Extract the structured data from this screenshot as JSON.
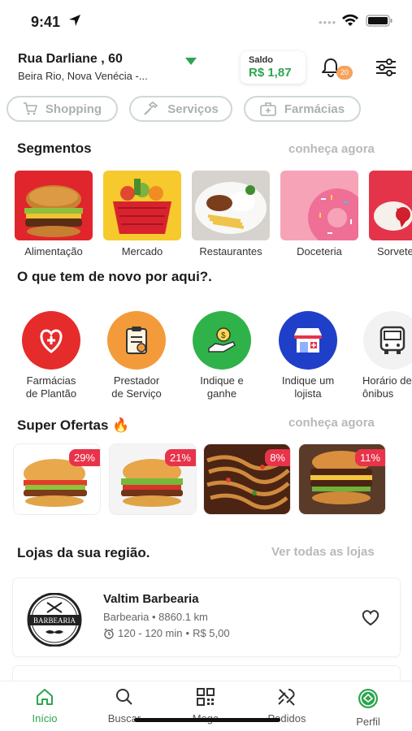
{
  "status": {
    "time": "9:41"
  },
  "header": {
    "street": "Rua Darliane , 60",
    "city": "Beira Rio, Nova Venécia -...",
    "saldo_label": "Saldo",
    "saldo_value": "R$ 1,87",
    "notifications": "20"
  },
  "chips": [
    {
      "label": "Shopping",
      "icon": "cart-icon"
    },
    {
      "label": "Serviços",
      "icon": "hammer-icon"
    },
    {
      "label": "Farmácias",
      "icon": "medkit-icon"
    }
  ],
  "segments": {
    "title": "Segmentos",
    "link": "conheça agora",
    "items": [
      {
        "label": "Alimentação"
      },
      {
        "label": "Mercado"
      },
      {
        "label": "Restaurantes"
      },
      {
        "label": "Doceteria"
      },
      {
        "label": "Sorvete"
      }
    ]
  },
  "news": {
    "title": "O que tem de novo por aqui?.",
    "items": [
      {
        "line1": "Farmácias",
        "line2": "de Plantão"
      },
      {
        "line1": "Prestador",
        "line2": "de Serviço"
      },
      {
        "line1": "Indique e",
        "line2": "ganhe"
      },
      {
        "line1": "Indique um",
        "line2": "lojista"
      },
      {
        "line1": "Horário de",
        "line2": "ônibus"
      }
    ]
  },
  "offers": {
    "title": "Super Ofertas 🔥",
    "link": "conheça agora",
    "items": [
      {
        "discount": "29%"
      },
      {
        "discount": "21%"
      },
      {
        "discount": "8%"
      },
      {
        "discount": "11%"
      }
    ]
  },
  "stores": {
    "title": "Lojas da sua região.",
    "link": "Ver todas as lojas",
    "items": [
      {
        "name": "Valtim Barbearia",
        "logo_text": "BARBEARIA",
        "category": "Barbearia",
        "distance": "8860.1 km",
        "time": "120 - 120 min",
        "fee": "R$ 5,00"
      }
    ]
  },
  "tabs": [
    {
      "label": "Início",
      "active": true
    },
    {
      "label": "Buscar"
    },
    {
      "label": "Mega"
    },
    {
      "label": "Pedidos"
    },
    {
      "label": "Perfil"
    }
  ],
  "colors": {
    "accent": "#2ea44f",
    "badge": "#e8334a",
    "notif": "#f7a25c"
  }
}
